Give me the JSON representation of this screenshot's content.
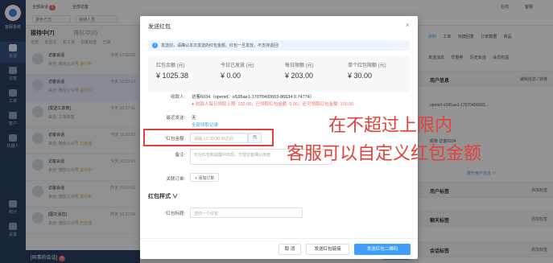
{
  "app": {
    "rail_logo_label": "客服系统"
  },
  "rail": [
    {
      "label": "会话"
    },
    {
      "label": "访客"
    },
    {
      "label": "工单"
    },
    {
      "label": "客户"
    },
    {
      "label": "机器人"
    },
    {
      "label": "统计"
    },
    {
      "label": "设置"
    }
  ],
  "topbar": {
    "tab1": "全部会话",
    "tab1_badge": "2",
    "tab2": "全部访客",
    "select1": "排序方式",
    "select2": "接待人员",
    "right_status": "在线",
    "right_user": "客服"
  },
  "conv": {
    "tab_active": "接待中(7)",
    "tab_other": "排队中(0)",
    "filters": [
      "全部",
      "有留言",
      "有工单",
      "访客标签",
      "已读"
    ],
    "items": [
      {
        "name": "访客会话",
        "time": "今天 17:02:02",
        "msg": "来自: 微信公众号",
        "tag": "进行中"
      },
      {
        "name": "访客会话",
        "time": "今天 16:53:14",
        "msg": "来自: 微信公众号",
        "tag": "进行中"
      },
      {
        "name": "[发送工单表]",
        "time": "今天 15:17:41",
        "msg": "来自: 工单标签",
        "tag": ""
      },
      {
        "name": "访客会话",
        "time": "今天 11:10:22",
        "msg": "来自: 微信公众号",
        "tag": "已处理"
      },
      {
        "name": "访客会话",
        "time": "今天 10:13:15",
        "msg": "来自: 微信公众号",
        "tag": "进行中"
      },
      {
        "name": "访客会话",
        "time": "昨天 19:02:02",
        "msg": "来自: 微信公众号",
        "tag": "进行中"
      },
      {
        "name": "[图文消息]",
        "time": "昨天 16:37:00",
        "msg": "来自: 微信公众号",
        "tag": "已处理"
      }
    ],
    "footer_label": "[同事的会话]",
    "footer_badge": "0"
  },
  "chat": {
    "send_label": "发送"
  },
  "rpanel": {
    "tabs": [
      "资料",
      "工单",
      "快捷回复",
      "订单数据",
      "商品"
    ],
    "tabs2": [
      "发送消息",
      "优惠券",
      "历史轨迹",
      "会员权益"
    ],
    "sec_userinfo": "用户信息",
    "sec_userinfo_actions": "编辑信息 / 转移",
    "kv1": "openid",
    "kv1_val": "oS95ae1-17070400603...",
    "kv2": "昵称",
    "kv2_val": "访客6034",
    "more_link": "展开用户信息 ∨",
    "sec_tags": "用户标签",
    "add_tag": "添加标签",
    "sec_tags2": "聊天标签",
    "add_tag2": "添加标签",
    "sec_tags3": "会话标签",
    "add_tag3": "添加标签"
  },
  "modal": {
    "title": "发送红包",
    "close": "×",
    "notice": "发送前，请确认本次发送的红包金额。红包一旦发放，不支持退回!",
    "stats": [
      {
        "label": "红包余额 (元)",
        "value": "¥ 1025.38"
      },
      {
        "label": "今日已发放 (元)",
        "value": "¥ 0.00"
      },
      {
        "label": "每日限额 (元)",
        "value": "¥ 203.00"
      },
      {
        "label": "单个红包限额 (元)",
        "value": "¥ 30.00"
      }
    ],
    "receiver_label": "收款人:",
    "receiver_value": "访客6034（openid：oS95ae1-17070400603-86634 0.74774）",
    "receiver_warn": "收款人每日领取上限: 100.00，已领取红包金额: 0.00，还可领取红包金额: 100.00",
    "recent_label": "最近发送:",
    "recent_value": "无",
    "recent_link": "全部领取记录",
    "amount_label": "红包金额:",
    "amount_placeholder": "请输入0.30-30.00之间",
    "amount_unit": "元",
    "remark_label": "备注:",
    "remark_placeholder": "可在红包和提醒中出现，方便访客确认用途",
    "order_label": "关联订单:",
    "order_button": "+ 添加订单",
    "style_section": "红包样式 ∨",
    "greeting_label": "红包标题:",
    "greeting_placeholder": "送你一个红包",
    "btn_cancel": "取 消",
    "btn_link": "发送红包链接",
    "btn_qr": "发送红包二维码"
  },
  "annotation": {
    "line1": "在不超过上限内",
    "line2": "客服可以自定义红包金额"
  },
  "colors": {
    "primary": "#409eff",
    "warn": "#f56c6c",
    "rail": "#2a3f5f",
    "highlight": "#e3403a"
  }
}
